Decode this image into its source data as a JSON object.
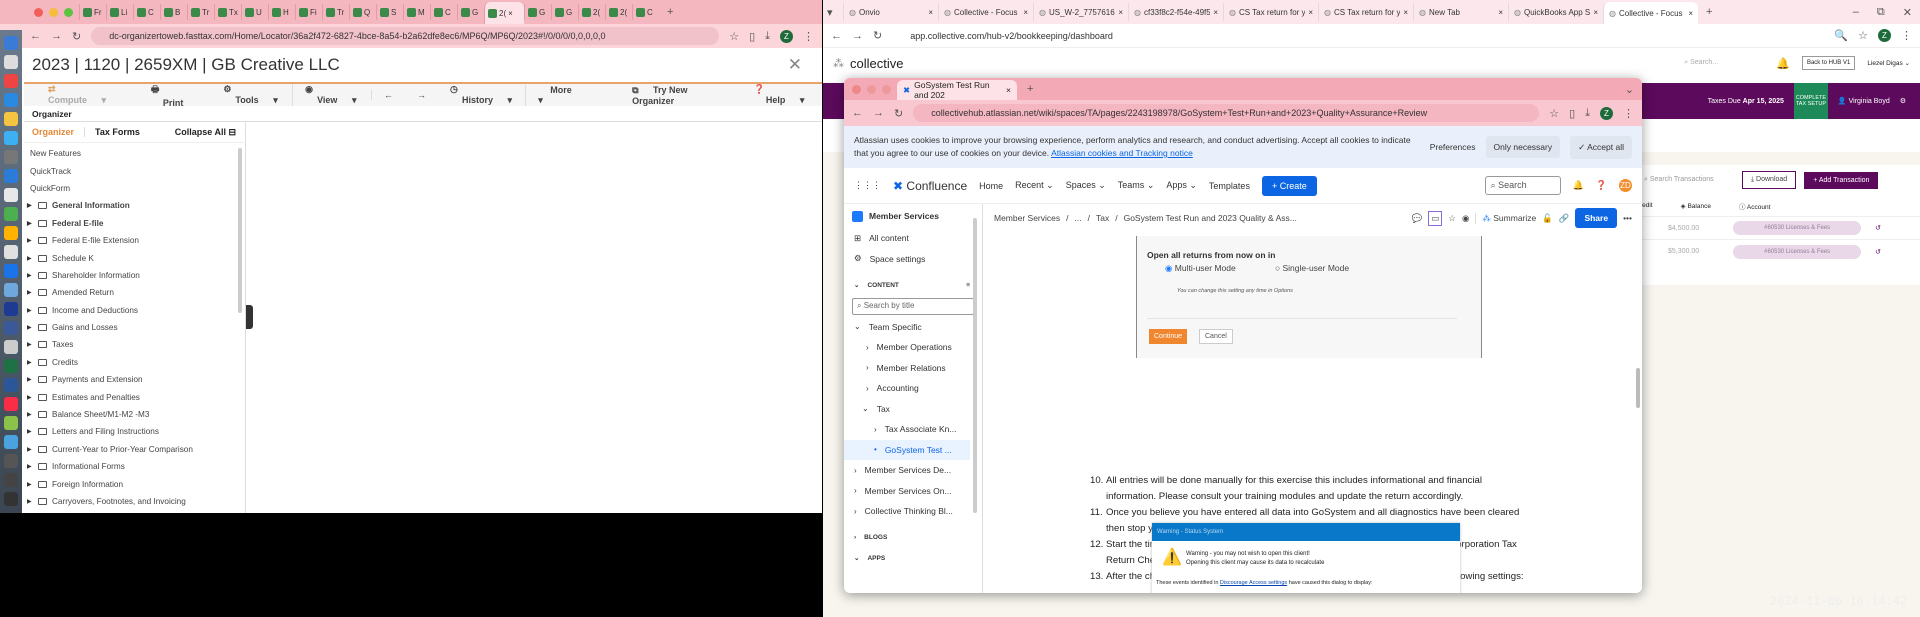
{
  "left_browser": {
    "tabs": [
      "Fr",
      "Li",
      "C",
      "B",
      "Tr",
      "Tx",
      "U",
      "H",
      "Fi",
      "Tr",
      "Q",
      "S",
      "M",
      "C",
      "G",
      "2(",
      "G",
      "G",
      "2(",
      "2(",
      "C"
    ],
    "url": "dc-organizertoweb.fasttax.com/Home/Locator/36a2f472-6827-4bce-8a54-b2a62dfe8ec6/MP6Q/MP6Q/2023#!/0/0/0/0,0,0,0,0",
    "page_title": "2023 | 1120 | 2659XM | GB Creative LLC",
    "toolbar": [
      "Compute",
      "Print",
      "Tools",
      "View",
      "History",
      "More"
    ],
    "try_new": "Try New Organizer",
    "help": "Help",
    "section": "Organizer",
    "tab_organizer": "Organizer",
    "tab_taxforms": "Tax Forms",
    "collapse_all": "Collapse All",
    "plain_items": [
      "New Features",
      "QuickTrack",
      "QuickForm"
    ],
    "folders": [
      "General Information",
      "Federal E-file",
      "Federal E-file Extension",
      "Schedule K",
      "Shareholder Information",
      "Amended Return",
      "Income and Deductions",
      "Gains and Losses",
      "Taxes",
      "Credits",
      "Payments and Extension",
      "Estimates and Penalties",
      "Balance Sheet/M1-M2 -M3",
      "Letters and Filing Instructions",
      "Current-Year to Prior-Year Comparison",
      "Informational Forms",
      "Foreign Information",
      "Carryovers, Footnotes, and Invoicing"
    ],
    "avatar": "Z"
  },
  "right_browser": {
    "tabs": [
      "Onvio",
      "Collective - Focus on",
      "US_W-2_7757616924",
      "cf33f8c2-f54e-49f5-8",
      "CS Tax return for yea",
      "CS Tax return for yea",
      "New Tab",
      "QuickBooks App Sto",
      "Collective - Focus on"
    ],
    "url": "app.collective.com/hub-v2/bookkeeping/dashboard",
    "logo": "collective",
    "search": "Search...",
    "back_hub": "Back to HUB V1",
    "user": "Liezel Digas",
    "taxes_due_label": "Taxes Due",
    "taxes_due_date": "Apr 15, 2025",
    "complete_setup": "COMPLETE TAX SETUP",
    "client": "Virginia Boyd",
    "search_tx": "Search Transactions",
    "download": "Download",
    "add_tx": "+ Add Transaction",
    "columns": [
      "redit",
      "Balance",
      "Account"
    ],
    "rows": [
      {
        "balance": "$4,500.00",
        "account": "#60530 Licenses & Fees"
      },
      {
        "balance": "$5,300.00",
        "account": "#60530 Licenses & Fees"
      }
    ]
  },
  "confluence": {
    "tab": "GoSystem Test Run and 202",
    "url": "collectivehub.atlassian.net/wiki/spaces/TA/pages/2243198978/GoSystem+Test+Run+and+2023+Quality+Assurance+Review",
    "cookie_text": "Atlassian uses cookies to improve your browsing experience, perform analytics and research, and conduct advertising. Accept all cookies to indicate that you agree to our use of cookies on your device.",
    "cookie_link": "Atlassian cookies and Tracking notice",
    "preferences": "Preferences",
    "only_necessary": "Only necessary",
    "accept_all": "Accept all",
    "brand": "Confluence",
    "nav": [
      "Home",
      "Recent",
      "Spaces",
      "Teams",
      "Apps",
      "Templates"
    ],
    "create": "+ Create",
    "search": "Search",
    "user_initials": "ZD",
    "space": "Member Services",
    "all_content": "All content",
    "space_settings": "Space settings",
    "content_label": "CONTENT",
    "search_title": "Search by title",
    "tree": [
      "Team Specific",
      "Member Operations",
      "Member Relations",
      "Accounting",
      "Tax",
      "Tax Associate Kn...",
      "GoSystem Test ...",
      "Member Services De...",
      "Member Services On...",
      "Collective Thinking Bl..."
    ],
    "blogs": "BLOGS",
    "apps": "APPS",
    "breadcrumb": [
      "Member Services",
      "...",
      "Tax",
      "GoSystem Test Run and 2023 Quality & Ass..."
    ],
    "summarize": "Summarize",
    "share": "Share",
    "dialog": {
      "heading": "Open all returns from now on in",
      "opt1": "Multi-user Mode",
      "opt2": "Single-user Mode",
      "note": "You can change this setting any time in Options",
      "continue": "Continue",
      "cancel": "Cancel"
    },
    "steps": [
      {
        "n": "10.",
        "text": "All entries will be done manually for this exercise this includes informational and financial information. Please consult your training modules and update the return accordingly."
      },
      {
        "n": "11.",
        "text": "Once you believe you have entered all data into GoSystem and all diagnostics have been cleared then stop your timer in Practice CS and mark the preparation task complete."
      },
      {
        "n": "12.",
        "text": "Start the timer for the \"Quality Assurance Review\" task and complete the 2023 S Corporation Tax Return Checklist."
      },
      {
        "n": "13.",
        "text": "After the checklist is complete then launch UltraTax and open the return with the following settings:"
      }
    ],
    "warning": {
      "title": "Warning - Status System",
      "l1": "Warning - you may not wish to open this client!",
      "l2": "Opening this client may cause its data to recalculate",
      "l3a": "These events identified in",
      "l3link": "Discourage Access settings",
      "l3b": "have caused this dialog to display:"
    }
  },
  "timestamp": "2024-11-06 16:14:42"
}
